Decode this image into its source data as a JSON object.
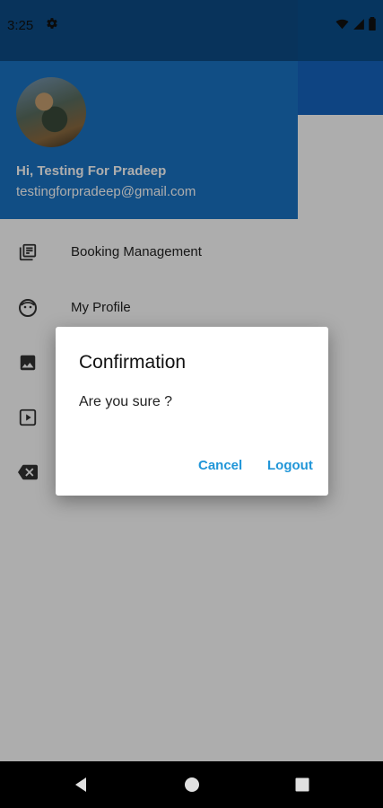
{
  "status_bar": {
    "time": "3:25",
    "icons": [
      "gear-icon",
      "wifi-icon",
      "signal-icon",
      "battery-icon"
    ]
  },
  "drawer": {
    "user_name": "Hi, Testing For Pradeep",
    "user_email": "testingforpradeep@gmail.com",
    "items": [
      {
        "label": "Booking Management",
        "icon": "list-icon"
      },
      {
        "label": "My Profile",
        "icon": "face-icon"
      },
      {
        "label": "",
        "icon": "image-icon"
      },
      {
        "label": "",
        "icon": "video-icon"
      },
      {
        "label": "",
        "icon": "backspace-icon"
      }
    ]
  },
  "dialog": {
    "title": "Confirmation",
    "message": "Are you sure ?",
    "cancel_label": "Cancel",
    "confirm_label": "Logout"
  },
  "colors": {
    "header_blue": "#1a73c4",
    "status_blue": "#0d4c86",
    "accent": "#2196d8"
  },
  "nav_bar": [
    "back-icon",
    "home-icon",
    "recents-icon"
  ]
}
